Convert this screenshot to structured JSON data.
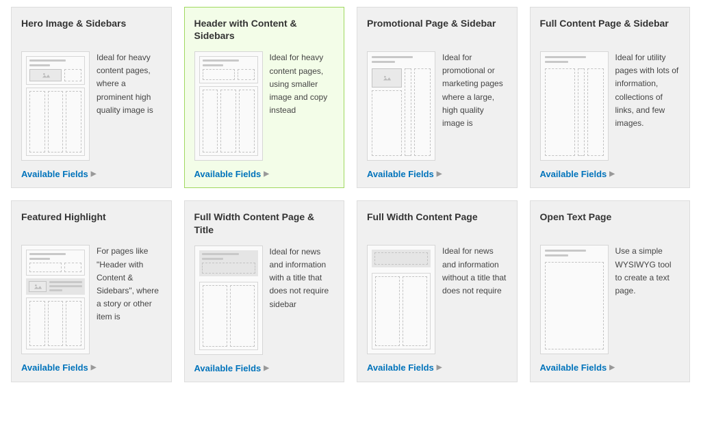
{
  "fields_label": "Available Fields",
  "cards": [
    {
      "title": "Hero Image & Sidebars",
      "desc": "Ideal for heavy content pages, where a prominent high quality image is",
      "selected": false,
      "thumb": "hero-sidebars"
    },
    {
      "title": "Header with Content & Sidebars",
      "desc": "Ideal for heavy content pages, using smaller image and copy instead",
      "selected": true,
      "thumb": "header-content-sidebars"
    },
    {
      "title": "Promotional Page & Sidebar",
      "desc": "Ideal for promotional or marketing pages where a large, high quality image is",
      "selected": false,
      "thumb": "promo-sidebar"
    },
    {
      "title": "Full Content Page & Sidebar",
      "desc": "Ideal for utility pages with lots of information, collections of links, and few images.",
      "selected": false,
      "thumb": "full-content-sidebar"
    },
    {
      "title": "Featured Highlight",
      "desc": "For pages like \"Header with Content & Sidebars\", where a story or other item is",
      "selected": false,
      "thumb": "featured-highlight"
    },
    {
      "title": "Full Width Content Page & Title",
      "desc": "Ideal for news and information with a title that does not require sidebar",
      "selected": false,
      "thumb": "full-width-title"
    },
    {
      "title": "Full Width Content Page",
      "desc": "Ideal for news and information without a title that does not require",
      "selected": false,
      "thumb": "full-width"
    },
    {
      "title": "Open Text Page",
      "desc": "Use a simple WYSIWYG tool to create a text page.",
      "selected": false,
      "thumb": "open-text"
    }
  ]
}
